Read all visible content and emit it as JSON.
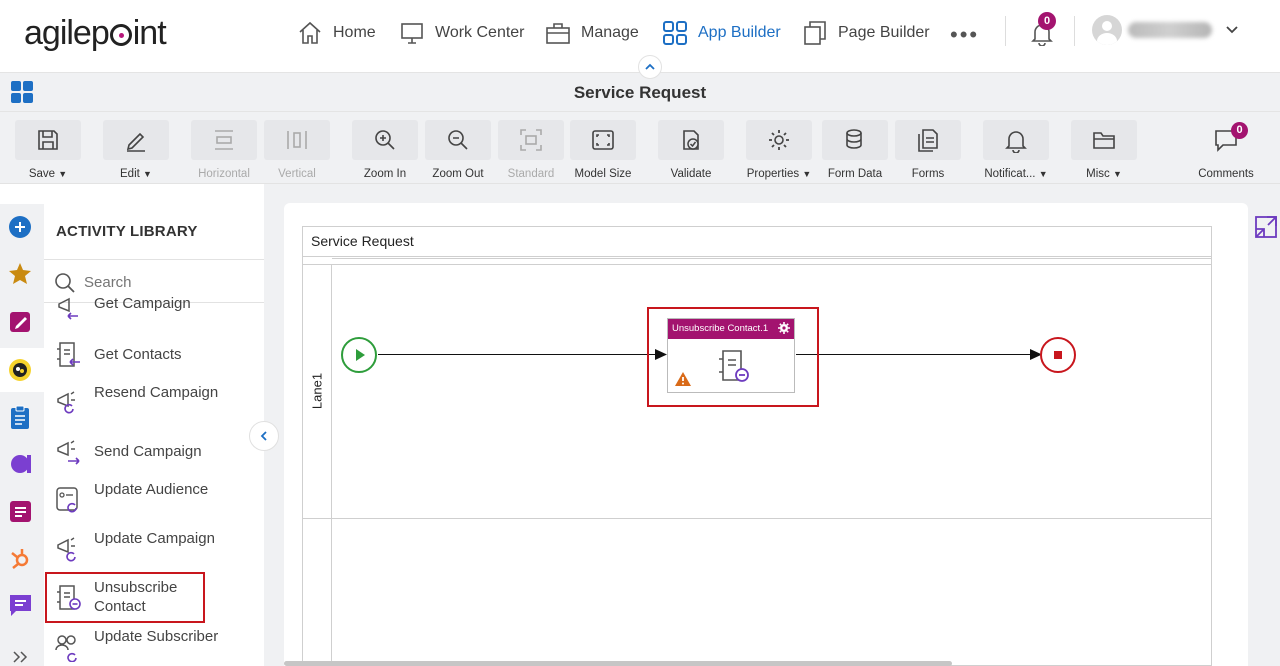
{
  "brand": {
    "logo_text_a": "agilep",
    "logo_text_b": "int"
  },
  "nav": {
    "home": "Home",
    "work_center": "Work Center",
    "manage": "Manage",
    "app_builder": "App Builder",
    "page_builder": "Page Builder",
    "more": "•••",
    "notifications_count": "0"
  },
  "title_bar": {
    "title": "Service Request"
  },
  "toolbar": {
    "save": "Save",
    "edit": "Edit",
    "horizontal": "Horizontal",
    "vertical": "Vertical",
    "zoom_in": "Zoom In",
    "zoom_out": "Zoom Out",
    "standard": "Standard",
    "model_size": "Model Size",
    "validate": "Validate",
    "properties": "Properties",
    "form_data": "Form Data",
    "forms": "Forms",
    "notifications": "Notificat...",
    "misc": "Misc",
    "comments": "Comments",
    "comments_count": "0"
  },
  "library": {
    "title": "ACTIVITY LIBRARY",
    "search_placeholder": "Search",
    "items": [
      {
        "label": "Get Campaign"
      },
      {
        "label": "Get Contacts"
      },
      {
        "label": "Resend Campaign"
      },
      {
        "label": "Send Campaign"
      },
      {
        "label": "Update Audience"
      },
      {
        "label": "Update Campaign"
      },
      {
        "label": "Unsubscribe Contact"
      },
      {
        "label": "Update Subscriber"
      }
    ]
  },
  "canvas": {
    "pool_title": "Service Request",
    "lane": "Lane1",
    "activity_title": "Unsubscribe Contact.1"
  },
  "colors": {
    "accent": "#a3136f",
    "nav_active": "#1d6fc4",
    "highlight": "#c8161d",
    "start": "#2e9d3b"
  }
}
